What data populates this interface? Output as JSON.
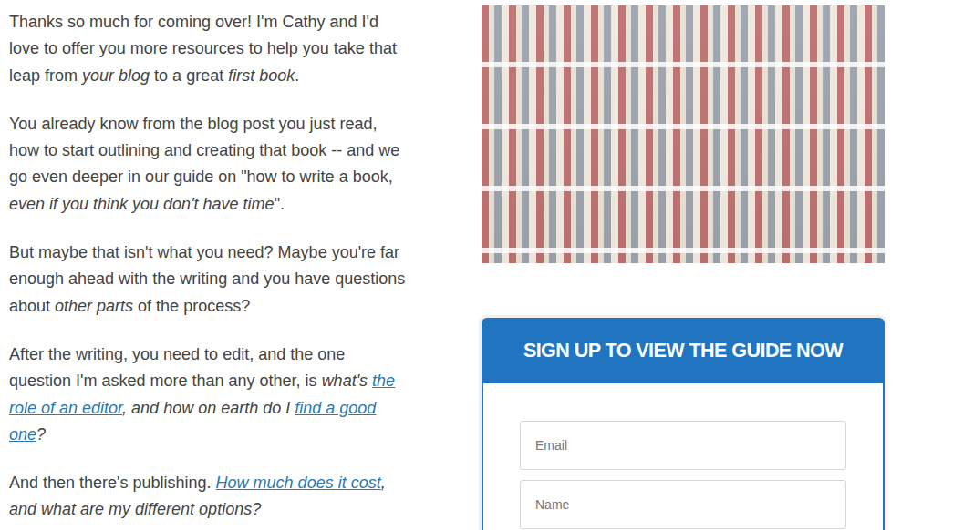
{
  "article": {
    "paragraphs": [
      [
        {
          "text": "Thanks so much for coming over! I'm Cathy and I'd love to offer you more resources to help you take that leap from ",
          "kind": "plain"
        },
        {
          "text": "your blog",
          "kind": "italic"
        },
        {
          "text": " to a great ",
          "kind": "plain"
        },
        {
          "text": "first book",
          "kind": "italic"
        },
        {
          "text": ".",
          "kind": "plain"
        }
      ],
      [
        {
          "text": "You already know from the blog post you just read, how to start outlining and creating that book -- and we go even deeper in our guide on \"how to write a book, ",
          "kind": "plain"
        },
        {
          "text": "even if you think you don't have time",
          "kind": "italic"
        },
        {
          "text": "\".",
          "kind": "plain"
        }
      ],
      [
        {
          "text": "But maybe that isn't what you need? Maybe you're far enough ahead with the writing and you have questions about ",
          "kind": "plain"
        },
        {
          "text": "other parts",
          "kind": "italic"
        },
        {
          "text": " of the process?",
          "kind": "plain"
        }
      ],
      [
        {
          "text": "After the writing, you need to edit, and the one question I'm asked more than any other, is ",
          "kind": "plain"
        },
        {
          "text": "what's ",
          "kind": "italic"
        },
        {
          "text": "the role of an editor",
          "kind": "link"
        },
        {
          "text": ", and how on earth do I ",
          "kind": "italic"
        },
        {
          "text": "find a good one",
          "kind": "link"
        },
        {
          "text": "?",
          "kind": "italic"
        }
      ],
      [
        {
          "text": "And then there's publishing. ",
          "kind": "plain"
        },
        {
          "text": "How much does it cost",
          "kind": "link"
        },
        {
          "text": ", and what are my different options?",
          "kind": "italic"
        }
      ]
    ]
  },
  "signup": {
    "title": "SIGN UP TO VIEW THE GUIDE NOW",
    "fields": [
      {
        "placeholder": "Email"
      },
      {
        "placeholder": "Name"
      }
    ]
  }
}
